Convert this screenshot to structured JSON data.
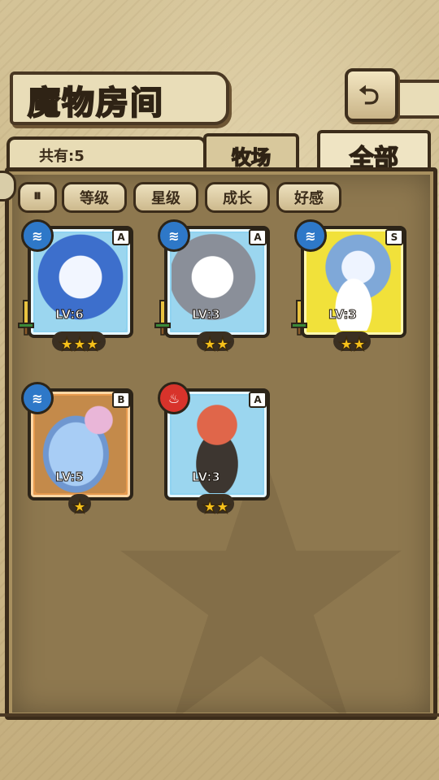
{
  "header": {
    "title": "魔物房间",
    "back_icon": "back-arrow-icon"
  },
  "tabs": {
    "count_label": "共有:5",
    "ranch": "牧场",
    "all": "全部",
    "active": "全部"
  },
  "sort": {
    "toggle": "⏸",
    "buttons": [
      "等级",
      "星级",
      "成长",
      "好感"
    ]
  },
  "monsters": [
    {
      "element": "water",
      "element_glyph": "≋",
      "rank": "A",
      "level": "LV:6",
      "stars": "★★★",
      "frame": "blue"
    },
    {
      "element": "water",
      "element_glyph": "≋",
      "rank": "A",
      "level": "LV:3",
      "stars": "★★",
      "frame": "blue"
    },
    {
      "element": "water",
      "element_glyph": "≋",
      "rank": "S",
      "level": "LV:3",
      "stars": "★★",
      "frame": "yellow"
    },
    {
      "element": "water",
      "element_glyph": "≋",
      "rank": "B",
      "level": "LV:5",
      "stars": "★",
      "frame": "orange"
    },
    {
      "element": "fire",
      "element_glyph": "♨",
      "rank": "A",
      "level": "LV:3",
      "stars": "★★",
      "frame": "blue"
    }
  ],
  "colors": {
    "water": "#2e78c8",
    "fire": "#d8332b",
    "blue_frame": "#8fd3f0",
    "yellow_frame": "#f1e13a",
    "orange_frame": "#e69a4e"
  }
}
